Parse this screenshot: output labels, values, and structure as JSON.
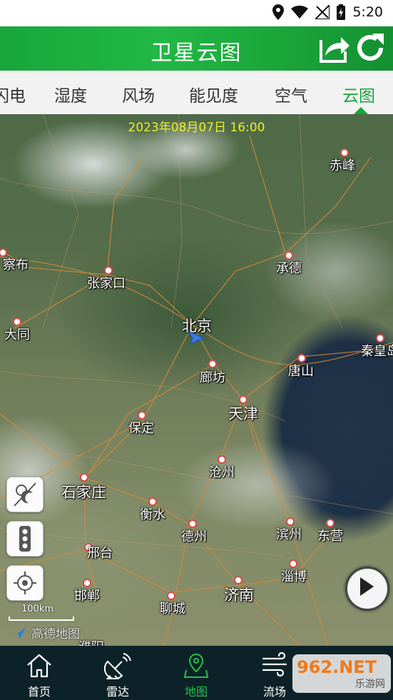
{
  "status_bar": {
    "time": "5:20"
  },
  "header": {
    "title": "卫星云图"
  },
  "tabs": [
    {
      "label": "闪电"
    },
    {
      "label": "湿度"
    },
    {
      "label": "风场"
    },
    {
      "label": "能见度"
    },
    {
      "label": "空气"
    },
    {
      "label": "云图",
      "active": true
    }
  ],
  "map": {
    "timestamp": "2023年08月07日 16:00",
    "scale_label": "100km",
    "logo_text": "高德地图",
    "cities": [
      "赤峰",
      "察布",
      "承德",
      "张家口",
      "北京",
      "大同",
      "秦皇岛",
      "唐山",
      "廊坊",
      "天津",
      "保定",
      "沧州",
      "石家庄",
      "衡水",
      "德州",
      "滨州",
      "东营",
      "邢台",
      "淄博",
      "邯郸",
      "济南",
      "聊城",
      "濮阳"
    ]
  },
  "bottom_nav": [
    {
      "label": "首页"
    },
    {
      "label": "雷达"
    },
    {
      "label": "地图",
      "active": true
    },
    {
      "label": "流场"
    },
    {
      "label": ""
    }
  ],
  "watermark": {
    "main": "962.NET",
    "sub": "乐游网"
  },
  "colors": {
    "accent": "#13a83a",
    "nav_bg": "#0d2228",
    "timestamp": "#e9ef2a"
  },
  "icons": [
    "location-icon",
    "wifi-icon",
    "signal-icon",
    "battery-icon",
    "share-icon",
    "refresh-icon",
    "day-night-icon",
    "traffic-light-icon",
    "locate-icon",
    "play-icon",
    "home-icon",
    "radar-icon",
    "map-icon",
    "flow-icon"
  ]
}
